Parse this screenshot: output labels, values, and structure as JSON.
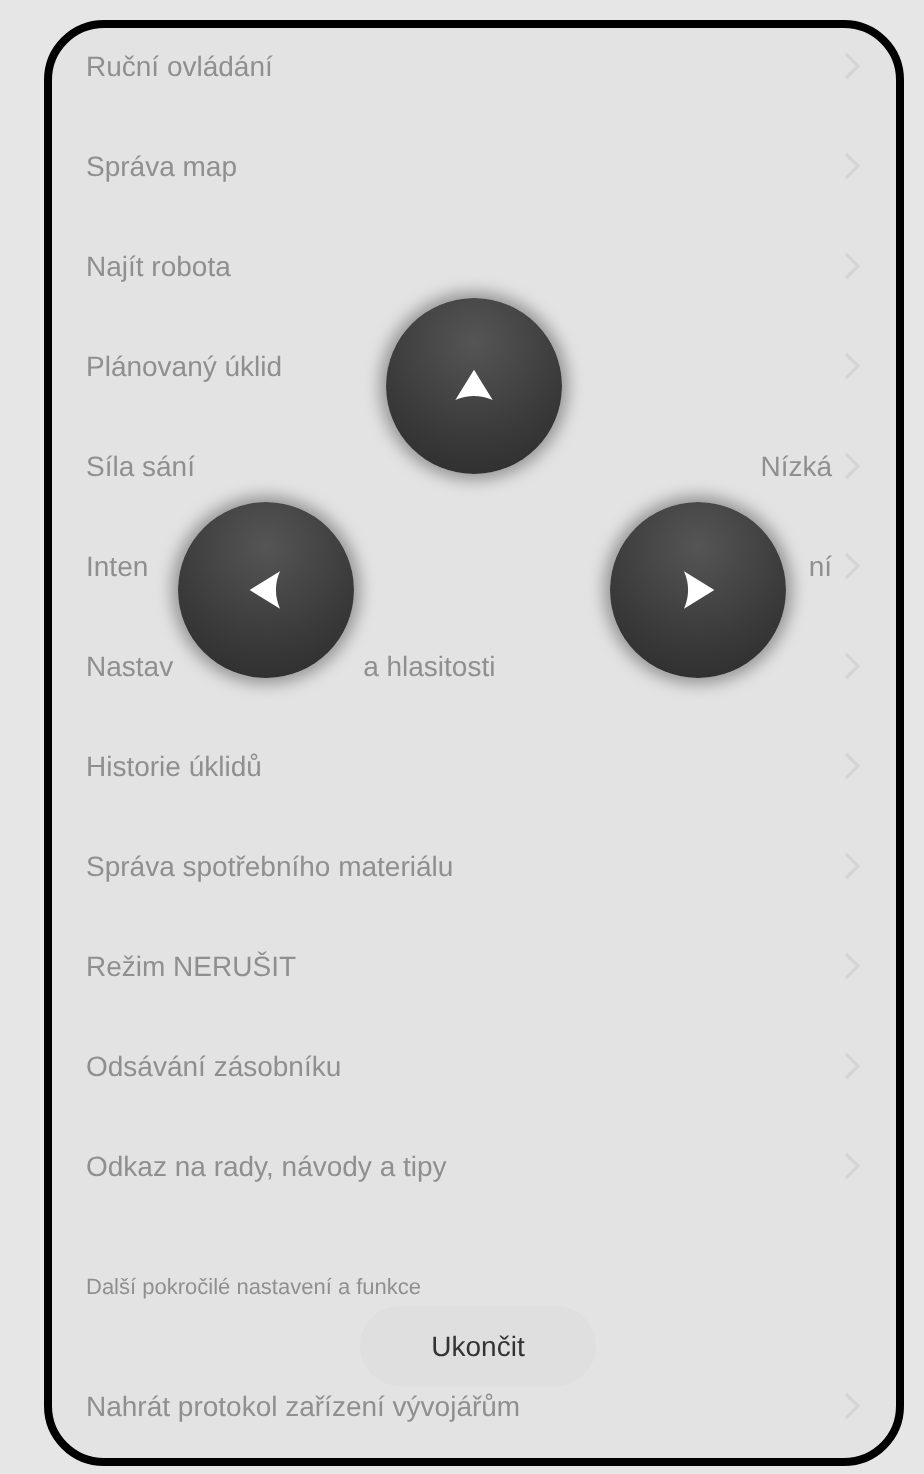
{
  "menu": [
    {
      "label": "Ruční ovládání"
    },
    {
      "label": "Správa map"
    },
    {
      "label": "Najít robota"
    },
    {
      "label": "Plánovaný úklid"
    },
    {
      "label": "Síla sání",
      "value": "Nízká"
    },
    {
      "label": "Inten",
      "value": "ní"
    },
    {
      "label": "Nastav",
      "label_after": "a hlasitosti"
    },
    {
      "label": "Historie úklidů"
    },
    {
      "label": "Správa spotřebního materiálu"
    },
    {
      "label": "Režim NERUŠIT"
    },
    {
      "label": "Odsávání zásobníku"
    },
    {
      "label": "Odkaz na rady, návody a tipy"
    }
  ],
  "section_header": "Další pokročilé nastavení a funkce",
  "menu_2": [
    {
      "label": "Nahrát protokol zařízení vývojářům"
    }
  ],
  "direction_pad": [
    {
      "kind": "up"
    },
    {
      "kind": "left"
    },
    {
      "kind": "right"
    }
  ],
  "exit_button": "Ukončit"
}
